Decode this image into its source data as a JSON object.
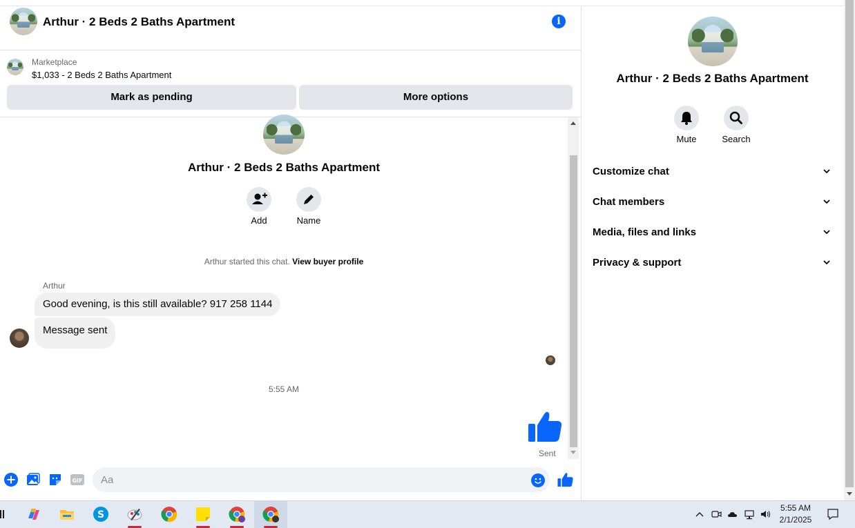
{
  "header": {
    "title": "Arthur · 2 Beds 2 Baths Apartment"
  },
  "marketplace": {
    "label": "Marketplace",
    "listing": "$1,033 - 2 Beds 2 Baths Apartment",
    "pending_label": "Mark as pending",
    "more_label": "More options"
  },
  "thread": {
    "title": "Arthur · 2 Beds 2 Baths Apartment",
    "add_label": "Add",
    "name_label": "Name",
    "started_text": "Arthur started this chat. ",
    "view_profile": "View buyer profile",
    "sender": "Arthur",
    "messages": [
      {
        "text": "Good evening, is this still available? 917 258 1144"
      },
      {
        "text": "Message sent"
      }
    ],
    "timestamp": "5:55 AM",
    "sent_label": "Sent"
  },
  "composer": {
    "placeholder": "Aa"
  },
  "panel": {
    "title": "Arthur · 2 Beds 2 Baths Apartment",
    "mute_label": "Mute",
    "search_label": "Search",
    "rows": [
      {
        "label": "Customize chat"
      },
      {
        "label": "Chat members"
      },
      {
        "label": "Media, files and links"
      },
      {
        "label": "Privacy & support"
      }
    ]
  },
  "taskbar": {
    "time": "5:55 AM",
    "date": "2/1/2025",
    "apps": [
      "copilot-icon",
      "file-explorer-icon",
      "skype-icon",
      "paint-icon",
      "chrome-icon",
      "sticky-notes-icon",
      "chrome-profile-icon",
      "chrome-active-icon"
    ]
  },
  "colors": {
    "accent": "#0866ff",
    "bubble": "#f0f0f0",
    "button": "#e4e6eb",
    "taskbar": "#e3e9f2"
  }
}
